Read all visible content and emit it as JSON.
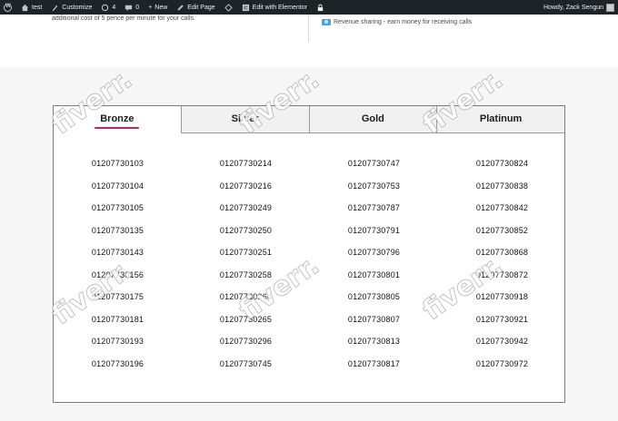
{
  "adminbar": {
    "site_name": "test",
    "customize": "Customize",
    "updates_count": "4",
    "comments_count": "0",
    "new_label": "New",
    "edit_page": "Edit Page",
    "edit_elementor": "Edit with Elementor",
    "howdy": "Howdy, Zack Sengun"
  },
  "upper": {
    "left_text": "additional cost of 5 pence per minute for your calls.",
    "right_text": "Revenue sharing - earn money for receiving calls"
  },
  "tabs": [
    {
      "label": "Bronze"
    },
    {
      "label": "Silver"
    },
    {
      "label": "Gold"
    },
    {
      "label": "Platinum"
    }
  ],
  "numbers": {
    "col0": [
      "01207730103",
      "01207730104",
      "01207730105",
      "01207730135",
      "01207730143",
      "01207730156",
      "01207730175",
      "01207730181",
      "01207730193",
      "01207730196"
    ],
    "col1": [
      "01207730214",
      "01207730216",
      "01207730249",
      "01207730250",
      "01207730251",
      "01207730258",
      "01207730264",
      "01207730265",
      "01207730296",
      "01207730745"
    ],
    "col2": [
      "01207730747",
      "01207730753",
      "01207730787",
      "01207730791",
      "01207730796",
      "01207730801",
      "01207730805",
      "01207730807",
      "01207730813",
      "01207730817"
    ],
    "col3": [
      "01207730824",
      "01207730838",
      "01207730842",
      "01207730852",
      "01207730868",
      "01207730872",
      "01207730918",
      "01207730921",
      "01207730942",
      "01207730972"
    ]
  },
  "watermark": "fiverr."
}
